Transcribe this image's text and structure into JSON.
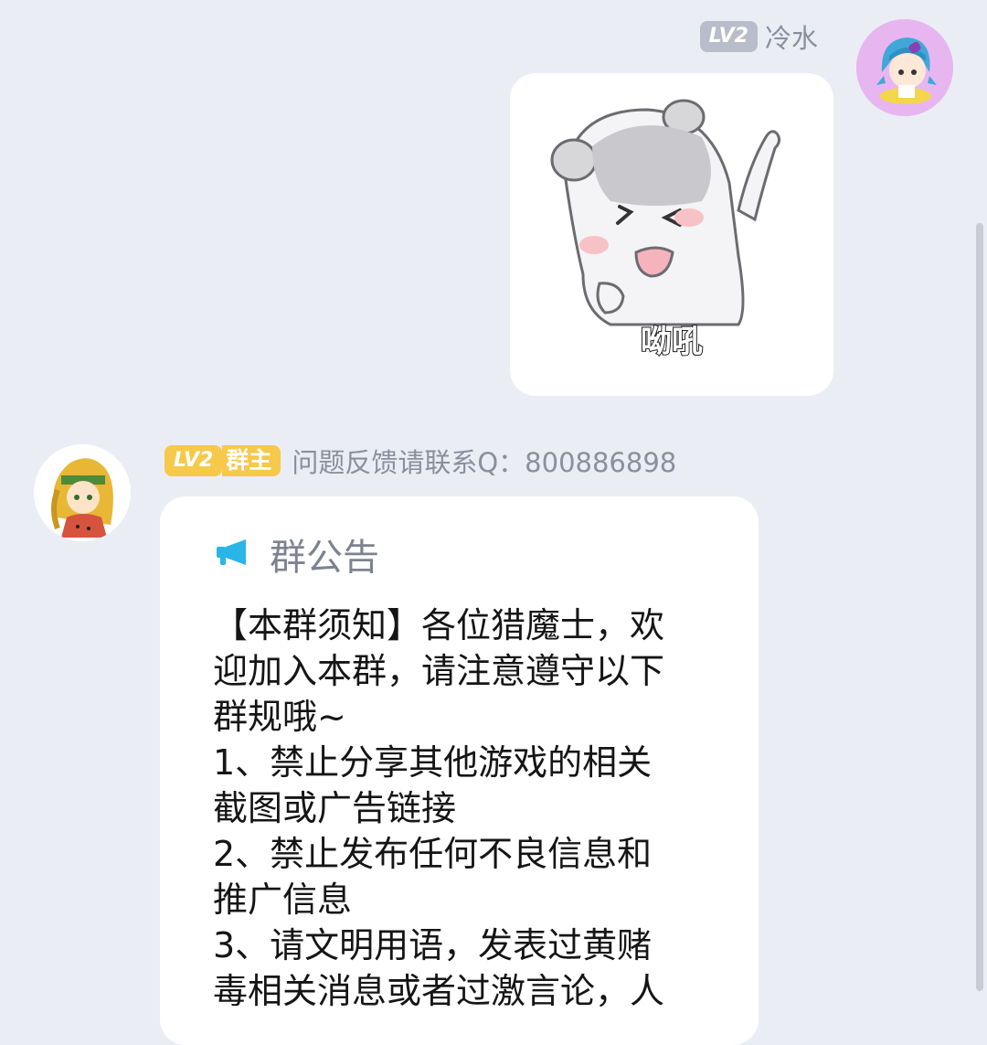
{
  "messages": [
    {
      "side": "right",
      "level_badge": "LV2",
      "sender_name": "冷水",
      "sticker_caption": "呦吼"
    },
    {
      "side": "left",
      "level_badge": "LV2",
      "role_badge": "群主",
      "sender_name": "问题反馈请联系Q：800886898",
      "announcement": {
        "title": "群公告",
        "lines": [
          "【本群须知】各位猎魔士，欢",
          "迎加入本群，请注意遵守以下",
          "群规哦~",
          "1、禁止分享其他游戏的相关",
          "截图或广告链接",
          "2、禁止发布任何不良信息和",
          "推广信息",
          "3、请文明用语，发表过黄赌",
          "毒相关消息或者过激言论，人"
        ]
      }
    }
  ],
  "colors": {
    "background": "#ebedf5",
    "level_badge_gray": "#b9bdc9",
    "level_badge_owner": "#f6c94a",
    "announcement_icon": "#29b6e6"
  },
  "icons": {
    "announcement": "megaphone-icon"
  }
}
